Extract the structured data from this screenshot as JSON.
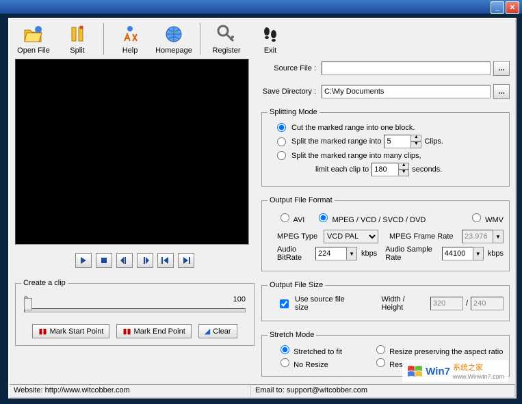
{
  "toolbar": {
    "open_file": "Open File",
    "split": "Split",
    "help": "Help",
    "homepage": "Homepage",
    "register": "Register",
    "exit": "Exit"
  },
  "source_file_label": "Source File :",
  "source_file_value": "",
  "save_dir_label": "Save Directory :",
  "save_dir_value": "C:\\My Documents",
  "splitting_mode": {
    "legend": "Splitting Mode",
    "opt1": "Cut the marked range into one block.",
    "opt2_pre": "Split the marked range into",
    "opt2_val": "5",
    "opt2_suf": "Clips.",
    "opt3": "Split the marked range into many clips,",
    "opt3_sub_pre": "limit each clip to",
    "opt3_val": "180",
    "opt3_suf": "seconds."
  },
  "output_format": {
    "legend": "Output File Format",
    "avi": "AVI",
    "mpeg": "MPEG / VCD / SVCD / DVD",
    "wmv": "WMV",
    "mpeg_type_label": "MPEG Type",
    "mpeg_type_value": "VCD PAL",
    "frame_rate_label": "MPEG Frame Rate",
    "frame_rate_value": "23.976",
    "audio_bitrate_label": "Audio BitRate",
    "audio_bitrate_value": "224",
    "audio_bitrate_unit": "kbps",
    "sample_rate_label": "Audio Sample Rate",
    "sample_rate_value": "44100",
    "sample_rate_unit": "kbps"
  },
  "create_clip": {
    "legend": "Create a clip",
    "start": "0",
    "end": "100",
    "mark_start": "Mark Start Point",
    "mark_end": "Mark End Point",
    "clear": "Clear"
  },
  "output_size": {
    "legend": "Output File Size",
    "use_source": "Use source file size",
    "wh_label": "Width / Height",
    "width": "320",
    "height": "240"
  },
  "stretch": {
    "legend": "Stretch Mode",
    "fit": "Stretched to fit",
    "preserve": "Resize preserving the aspect ratio",
    "no_resize": "No Resize",
    "crop": "Resize crop"
  },
  "status": {
    "website": "Website: http://www.witcobber.com",
    "email": "Email to: support@witcobber.com"
  },
  "logo": {
    "brand": "Win7",
    "text1": "系统之家",
    "text2": "www.Winwin7.com"
  }
}
